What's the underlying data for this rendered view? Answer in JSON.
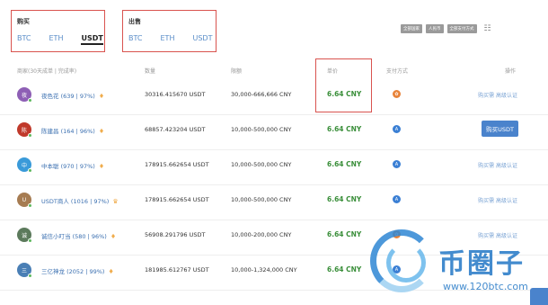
{
  "buy_tab": {
    "title": "购买",
    "coins": [
      "BTC",
      "ETH",
      "USDT"
    ],
    "active": "USDT"
  },
  "sell_tab": {
    "title": "出售",
    "coins": [
      "BTC",
      "ETH",
      "USDT"
    ]
  },
  "filters": {
    "buttons": [
      "全部国家",
      "人民币",
      "全部支付方式"
    ],
    "filter_icon": "list-filter-icon"
  },
  "table": {
    "headers": {
      "merchant": "商家(30天成单 | 完成率)",
      "quantity": "数量",
      "limit": "限额",
      "price": "单价",
      "payment": "支付方式",
      "action": "操作"
    },
    "rows": [
      {
        "avatar": "夜",
        "avatar_color": "#8e5fb5",
        "merchant": "夜色花 (639 | 97%)",
        "badge": "diamond",
        "quantity": "30316.415670 USDT",
        "limit": "30,000-666,666 CNY",
        "price": "6.64 CNY",
        "pay_color": "#e8833a",
        "pay_glyph": "✿",
        "action": "购买需 高级认证"
      },
      {
        "avatar": "陈",
        "avatar_color": "#c0392b",
        "merchant": "陈建昌 (164 | 96%)",
        "badge": "diamond",
        "quantity": "68857.423204 USDT",
        "limit": "10,000-500,000 CNY",
        "price": "6.64 CNY",
        "pay_color": "#3a7fd4",
        "pay_glyph": "A",
        "button": "购买USDT"
      },
      {
        "avatar": "中",
        "avatar_color": "#3a9ad9",
        "merchant": "中本聪 (970 | 97%)",
        "badge": "diamond",
        "quantity": "178915.662654 USDT",
        "limit": "10,000-500,000 CNY",
        "price": "6.64 CNY",
        "pay_color": "#3a7fd4",
        "pay_glyph": "A",
        "action": "购买需 高级认证"
      },
      {
        "avatar": "U",
        "avatar_color": "#a67c52",
        "merchant": "USDT商人 (1016 | 97%)",
        "badge": "crown",
        "quantity": "178915.662654 USDT",
        "limit": "10,000-500,000 CNY",
        "price": "6.64 CNY",
        "pay_color": "#3a7fd4",
        "pay_glyph": "A",
        "action": "购买需 高级认证"
      },
      {
        "avatar": "诚",
        "avatar_color": "#5c7a5c",
        "merchant": "诚信小叮当 (580 | 96%)",
        "badge": "diamond",
        "quantity": "56908.291796 USDT",
        "limit": "10,000-200,000 CNY",
        "price": "6.64 CNY",
        "pay_color": "#e8833a",
        "pay_glyph": "✿",
        "action": "购买需 高级认证"
      },
      {
        "avatar": "三",
        "avatar_color": "#4a7fb5",
        "merchant": "三亿神龙 (2052 | 99%)",
        "badge": "diamond",
        "quantity": "181985.612767 USDT",
        "limit": "10,000-1,324,000 CNY",
        "price": "6.64 CNY",
        "pay_color": "#3a7fd4",
        "pay_glyph": "A",
        "action": ""
      }
    ]
  },
  "watermark": {
    "text": "币圈子",
    "url": "www.120btc.com"
  }
}
